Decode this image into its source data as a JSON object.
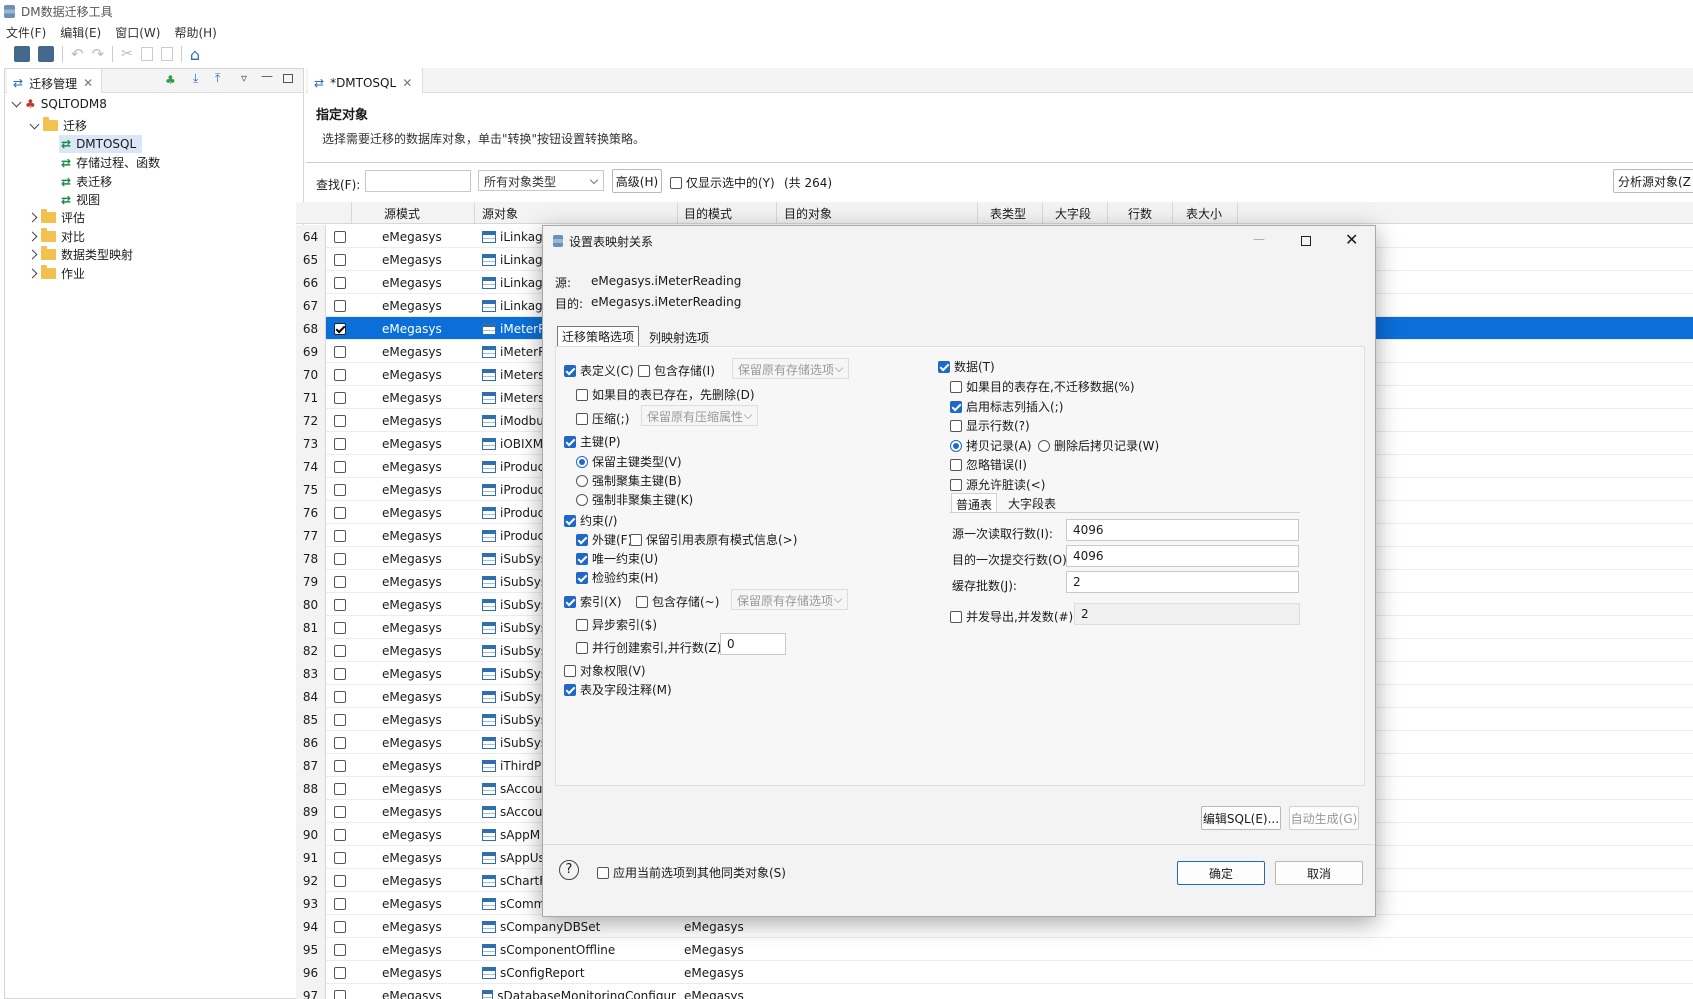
{
  "window": {
    "title": "DM数据迁移工具"
  },
  "menu": [
    "文件(F)",
    "编辑(E)",
    "窗口(W)",
    "帮助(H)"
  ],
  "left_panel": {
    "tab": "迁移管理",
    "tree": {
      "root": "SQLTODM8",
      "folder": "迁移",
      "items": [
        "DMTOSQL",
        "存储过程、函数",
        "表迁移",
        "视图"
      ],
      "others": [
        "评估",
        "对比",
        "数据类型映射",
        "作业"
      ]
    }
  },
  "editor": {
    "tab": "*DMTOSQL",
    "heading": "指定对象",
    "description": "选择需要迁移的数据库对象，单击\"转换\"按钮设置转换策略。",
    "filter": {
      "find_label": "查找(F):",
      "type_select": "所有对象类型",
      "advanced": "高级(H)",
      "only_selected": "仅显示选中的(Y)",
      "count": "(共 264)",
      "analyze": "分析源对象(Z"
    },
    "columns": [
      "源模式",
      "源对象",
      "目的模式",
      "目的对象",
      "表类型",
      "大字段",
      "行数",
      "表大小"
    ],
    "rows": [
      {
        "n": "64",
        "schema": "eMegasys",
        "obj": "iLinkag",
        "dst": ""
      },
      {
        "n": "65",
        "schema": "eMegasys",
        "obj": "iLinkag",
        "dst": ""
      },
      {
        "n": "66",
        "schema": "eMegasys",
        "obj": "iLinkag",
        "dst": ""
      },
      {
        "n": "67",
        "schema": "eMegasys",
        "obj": "iLinkag",
        "dst": ""
      },
      {
        "n": "68",
        "schema": "eMegasys",
        "obj": "iMeterR",
        "dst": "",
        "selected": true
      },
      {
        "n": "69",
        "schema": "eMegasys",
        "obj": "iMeterR",
        "dst": ""
      },
      {
        "n": "70",
        "schema": "eMegasys",
        "obj": "iMeters",
        "dst": ""
      },
      {
        "n": "71",
        "schema": "eMegasys",
        "obj": "iMeters",
        "dst": ""
      },
      {
        "n": "72",
        "schema": "eMegasys",
        "obj": "iModbu",
        "dst": ""
      },
      {
        "n": "73",
        "schema": "eMegasys",
        "obj": "iOBIXM",
        "dst": ""
      },
      {
        "n": "74",
        "schema": "eMegasys",
        "obj": "iProduc",
        "dst": ""
      },
      {
        "n": "75",
        "schema": "eMegasys",
        "obj": "iProduc",
        "dst": ""
      },
      {
        "n": "76",
        "schema": "eMegasys",
        "obj": "iProduc",
        "dst": ""
      },
      {
        "n": "77",
        "schema": "eMegasys",
        "obj": "iProduc",
        "dst": ""
      },
      {
        "n": "78",
        "schema": "eMegasys",
        "obj": "iSubSys",
        "dst": ""
      },
      {
        "n": "79",
        "schema": "eMegasys",
        "obj": "iSubSys",
        "dst": ""
      },
      {
        "n": "80",
        "schema": "eMegasys",
        "obj": "iSubSys",
        "dst": ""
      },
      {
        "n": "81",
        "schema": "eMegasys",
        "obj": "iSubSys",
        "dst": ""
      },
      {
        "n": "82",
        "schema": "eMegasys",
        "obj": "iSubSys",
        "dst": ""
      },
      {
        "n": "83",
        "schema": "eMegasys",
        "obj": "iSubSys",
        "dst": ""
      },
      {
        "n": "84",
        "schema": "eMegasys",
        "obj": "iSubSys",
        "dst": ""
      },
      {
        "n": "85",
        "schema": "eMegasys",
        "obj": "iSubSys",
        "dst": ""
      },
      {
        "n": "86",
        "schema": "eMegasys",
        "obj": "iSubSys",
        "dst": ""
      },
      {
        "n": "87",
        "schema": "eMegasys",
        "obj": "iThirdP",
        "dst": ""
      },
      {
        "n": "88",
        "schema": "eMegasys",
        "obj": "sAccou",
        "dst": ""
      },
      {
        "n": "89",
        "schema": "eMegasys",
        "obj": "sAccou",
        "dst": ""
      },
      {
        "n": "90",
        "schema": "eMegasys",
        "obj": "sAppM",
        "dst": ""
      },
      {
        "n": "91",
        "schema": "eMegasys",
        "obj": "sAppUs",
        "dst": ""
      },
      {
        "n": "92",
        "schema": "eMegasys",
        "obj": "sChartF",
        "dst": ""
      },
      {
        "n": "93",
        "schema": "eMegasys",
        "obj": "sComm",
        "dst": ""
      },
      {
        "n": "94",
        "schema": "eMegasys",
        "obj": "sCompanyDBSet",
        "dst": "eMegasys"
      },
      {
        "n": "95",
        "schema": "eMegasys",
        "obj": "sComponentOffline",
        "dst": "eMegasys"
      },
      {
        "n": "96",
        "schema": "eMegasys",
        "obj": "sConfigReport",
        "dst": "eMegasys"
      },
      {
        "n": "97",
        "schema": "eMegasys",
        "obj": "sDatabaseMonitoringConfigur",
        "dst": "eMegasys"
      }
    ]
  },
  "dialog": {
    "title": "设置表映射关系",
    "src_label": "源:",
    "src_value": "eMegasys.iMeterReading",
    "dst_label": "目的:",
    "dst_value": "eMegasys.iMeterReading",
    "tabs": [
      "迁移策略选项",
      "列映射选项"
    ],
    "left": {
      "table_def": "表定义(C)",
      "include_storage": "包含存储(I)",
      "keep_storage": "保留原有存储选项",
      "drop_if_exists": "如果目的表已存在，先删除(D)",
      "compress": "压缩(;)",
      "keep_compress": "保留原有压缩属性",
      "primary_key": "主键(P)",
      "pk_keep": "保留主键类型(V)",
      "pk_cluster": "强制聚集主键(B)",
      "pk_noncluster": "强制非聚集主键(K)",
      "constraint": "约束(/)",
      "foreign_key": "外键(F)",
      "keep_ref_schema": "保留引用表原有模式信息(>)",
      "unique": "唯一约束(U)",
      "check": "检验约束(H)",
      "index": "索引(X)",
      "index_storage": "包含存储(~)",
      "index_keep": "保留原有存储选项",
      "async_index": "异步索引($)",
      "parallel_index": "并行创建索引,并行数(Z):",
      "parallel_value": "0",
      "obj_priv": "对象权限(V)",
      "comments": "表及字段注释(M)"
    },
    "right": {
      "data": "数据(T)",
      "skip_if_exists": "如果目的表存在,不迁移数据(%)",
      "identity_insert": "启用标志列插入(;)",
      "show_rows": "显示行数(?)",
      "copy_records": "拷贝记录(A)",
      "delete_then_copy": "删除后拷贝记录(W)",
      "ignore_errors": "忽略错误(I)",
      "dirty_read": "源允许脏读(<)",
      "subtabs": [
        "普通表",
        "大字段表"
      ],
      "read_rows_label": "源一次读取行数(I):",
      "read_rows": "4096",
      "commit_rows_label": "目的一次提交行数(O):",
      "commit_rows": "4096",
      "batch_label": "缓存批数(J):",
      "batch": "2",
      "parallel_export": "并发导出,并发数(#):",
      "parallel_export_value": "2"
    },
    "edit_sql": "编辑SQL(E)...",
    "auto_gen": "自动生成(G)",
    "apply_all": "应用当前选项到其他同类对象(S)",
    "ok": "确定",
    "cancel": "取消"
  }
}
